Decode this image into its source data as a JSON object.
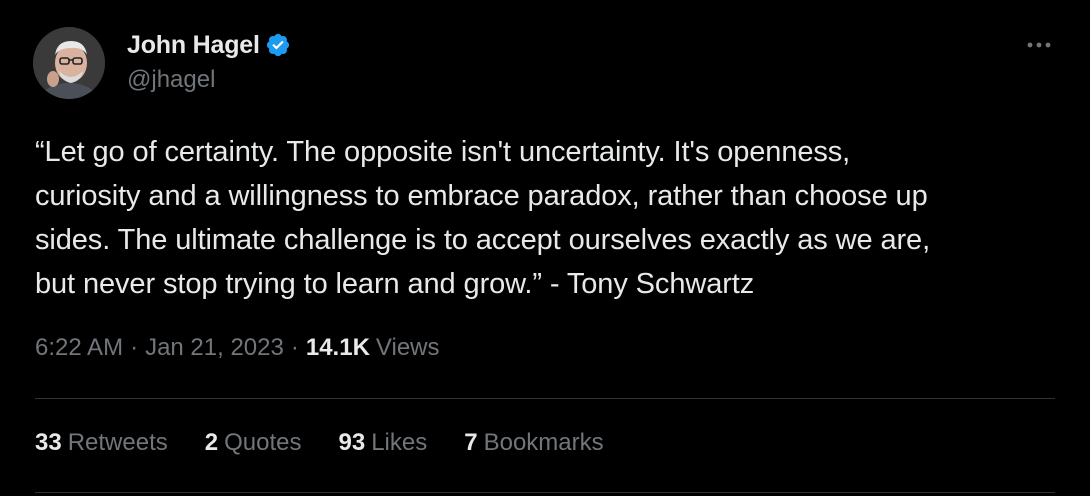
{
  "author": {
    "display_name": "John Hagel",
    "handle": "@jhagel",
    "verified": true,
    "verified_color": "#1d9bf0"
  },
  "tweet": {
    "text": "“Let go of certainty. The opposite isn't uncertainty. It's openness,\ncuriosity and a willingness to embrace paradox, rather than choose up\nsides. The ultimate challenge is to accept ourselves exactly as we are,\nbut never stop trying to learn and grow.” - Tony Schwartz",
    "time": "6:22 AM",
    "separator": "·",
    "date": "Jan 21, 2023",
    "views_count": "14.1K",
    "views_label": "Views"
  },
  "stats": [
    {
      "count": "33",
      "label": "Retweets"
    },
    {
      "count": "2",
      "label": "Quotes"
    },
    {
      "count": "93",
      "label": "Likes"
    },
    {
      "count": "7",
      "label": "Bookmarks"
    }
  ],
  "icons": {
    "more": "more-horizontal-icon",
    "verified": "verified-badge-icon"
  },
  "colors": {
    "background": "#000000",
    "primary_text": "#e7e9ea",
    "secondary_text": "#71767b",
    "divider": "#2f3336"
  }
}
